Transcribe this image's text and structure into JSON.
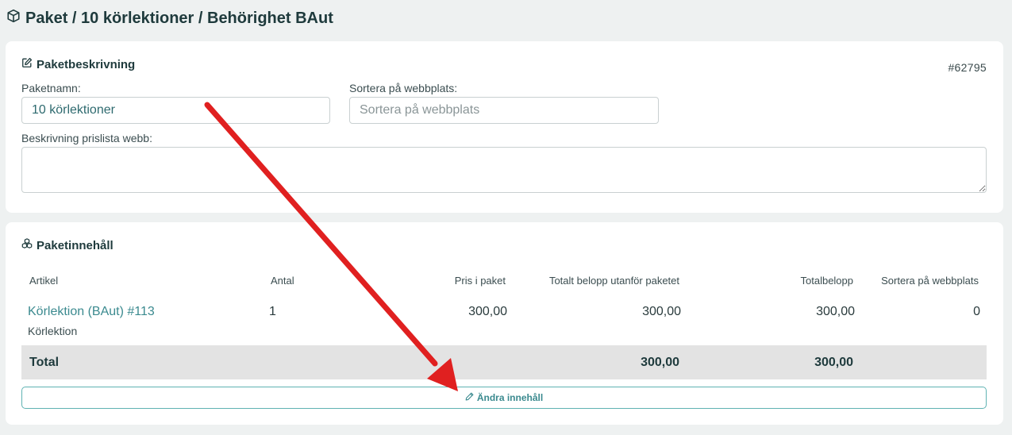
{
  "page": {
    "title": "Paket / 10 körlektioner / Behörighet BAut",
    "title_icon": "cube-icon"
  },
  "description_card": {
    "heading": "Paketbeskrivning",
    "heading_icon": "edit-icon",
    "id_tag": "#62795",
    "package_name_label": "Paketnamn:",
    "package_name_value": "10 körlektioner",
    "sort_label": "Sortera på webbplats:",
    "sort_value": "",
    "sort_placeholder": "Sortera på webbplats",
    "price_list_label": "Beskrivning prislista webb:",
    "price_list_value": ""
  },
  "content_card": {
    "heading": "Paketinnehåll",
    "heading_icon": "boxes-icon",
    "columns": [
      "Artikel",
      "Antal",
      "Pris i paket",
      "Totalt belopp utanför paketet",
      "Totalbelopp",
      "Sortera på webbplats"
    ],
    "rows": [
      {
        "article": "Körlektion (BAut) #113",
        "article_type": "Körlektion",
        "quantity": "1",
        "price_in_package": "300,00",
        "total_outside_package": "300,00",
        "total_amount": "300,00",
        "sort": "0"
      }
    ],
    "total": {
      "label": "Total",
      "total_outside_package": "300,00",
      "total_amount": "300,00"
    },
    "edit_button_label": "Ändra innehåll",
    "edit_button_icon": "pencil-icon"
  },
  "colors": {
    "accent": "#3b8a8f",
    "annotation_arrow": "#e02020",
    "background": "#eef1f1",
    "total_row_bg": "#e3e3e3"
  }
}
